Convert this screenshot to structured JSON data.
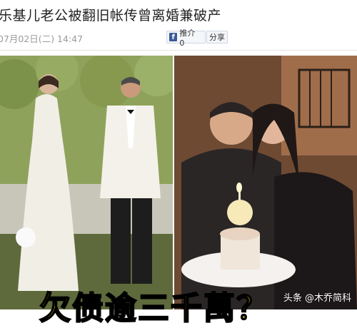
{
  "article": {
    "title": "乐基儿老公被翻旧帐传曾离婚兼破产",
    "date": "07月02日(二) 14:47"
  },
  "share": {
    "facebook_label": "推介 0",
    "share_label": "分享"
  },
  "image": {
    "caption": "欠债逾三千萬？",
    "watermark": "头条 @木乔简科"
  },
  "colors": {
    "caption_fill": "#ffe000",
    "caption_stroke": "#000000",
    "facebook_blue": "#3b5998"
  }
}
